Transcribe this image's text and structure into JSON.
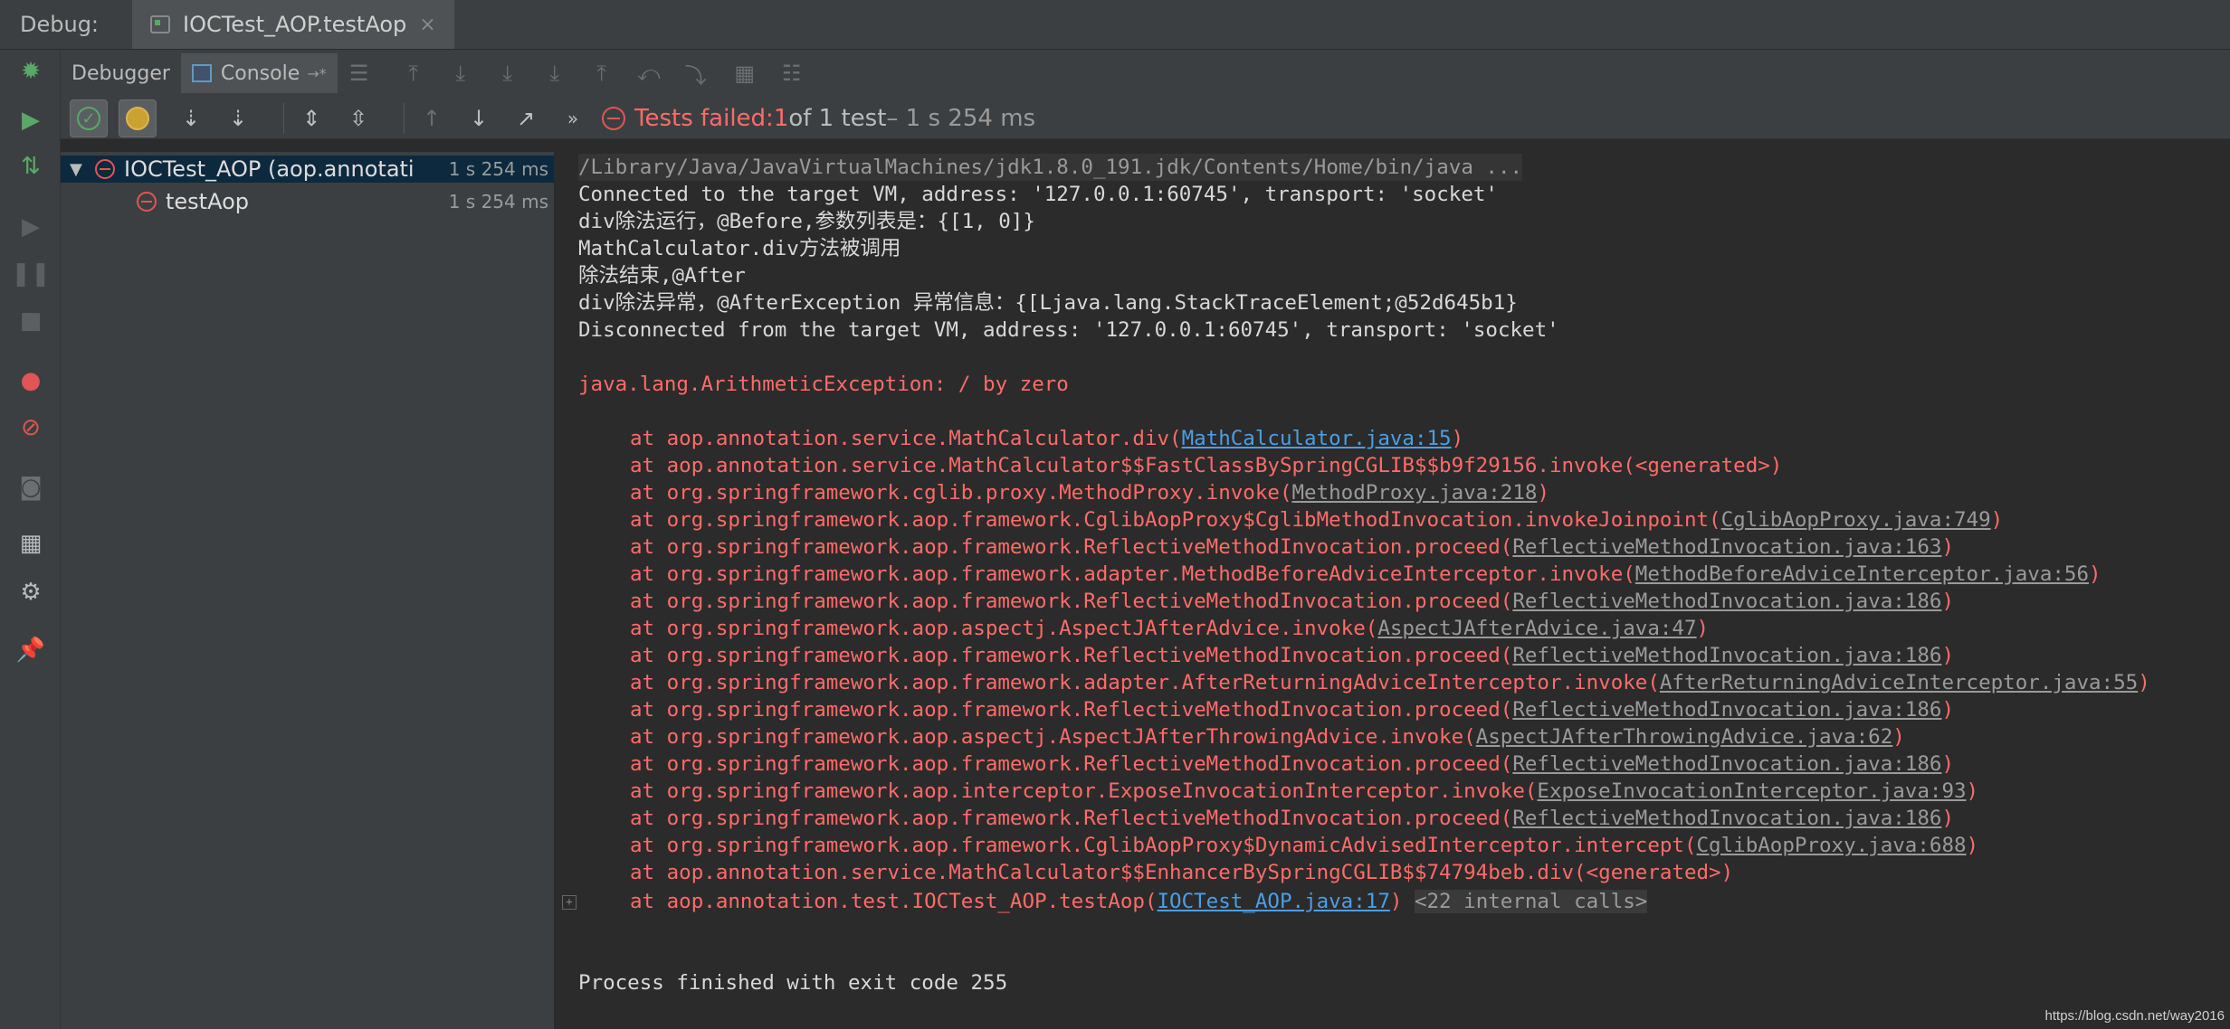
{
  "window": {
    "debug_label": "Debug:",
    "run_tab_label": "IOCTest_AOP.testAop",
    "run_tab_close": "×"
  },
  "toolbar": {
    "tab_debugger": "Debugger",
    "tab_console": "Console",
    "tab_console_pin": "→*",
    "overflow": "»"
  },
  "status": {
    "failed_prefix": "Tests failed: ",
    "failed_count": "1",
    "of_total": " of 1 test",
    "duration": " – 1 s 254 ms"
  },
  "tree": {
    "root_name": "IOCTest_AOP (aop.annotati",
    "root_time": "1 s 254 ms",
    "child_name": "testAop",
    "child_time": "1 s 254 ms"
  },
  "console": {
    "command": "/Library/Java/JavaVirtualMachines/jdk1.8.0_191.jdk/Contents/Home/bin/java ...",
    "lines": [
      "Connected to the target VM, address: '127.0.0.1:60745', transport: 'socket'",
      "div除法运行，@Before,参数列表是：{[1, 0]}",
      "MathCalculator.div方法被调用",
      "除法结束,@After",
      "div除法异常，@AfterException 异常信息：{[Ljava.lang.StackTraceElement;@52d645b1}",
      "Disconnected from the target VM, address: '127.0.0.1:60745', transport: 'socket'"
    ],
    "exception": "java.lang.ArithmeticException: / by zero",
    "stack": [
      {
        "pre": "at aop.annotation.service.MathCalculator.div(",
        "link": "MathCalculator.java:15",
        "post": ")"
      },
      {
        "pre": "at aop.annotation.service.MathCalculator$$FastClassBySpringCGLIB$$b9f29156.invoke(<generated>)",
        "link": "",
        "post": ""
      },
      {
        "pre": "at org.springframework.cglib.proxy.MethodProxy.invoke(",
        "link": "MethodProxy.java:218",
        "post": ")"
      },
      {
        "pre": "at org.springframework.aop.framework.CglibAopProxy$CglibMethodInvocation.invokeJoinpoint(",
        "link": "CglibAopProxy.java:749",
        "post": ")"
      },
      {
        "pre": "at org.springframework.aop.framework.ReflectiveMethodInvocation.proceed(",
        "link": "ReflectiveMethodInvocation.java:163",
        "post": ")"
      },
      {
        "pre": "at org.springframework.aop.framework.adapter.MethodBeforeAdviceInterceptor.invoke(",
        "link": "MethodBeforeAdviceInterceptor.java:56",
        "post": ")"
      },
      {
        "pre": "at org.springframework.aop.framework.ReflectiveMethodInvocation.proceed(",
        "link": "ReflectiveMethodInvocation.java:186",
        "post": ")"
      },
      {
        "pre": "at org.springframework.aop.aspectj.AspectJAfterAdvice.invoke(",
        "link": "AspectJAfterAdvice.java:47",
        "post": ")"
      },
      {
        "pre": "at org.springframework.aop.framework.ReflectiveMethodInvocation.proceed(",
        "link": "ReflectiveMethodInvocation.java:186",
        "post": ")"
      },
      {
        "pre": "at org.springframework.aop.framework.adapter.AfterReturningAdviceInterceptor.invoke(",
        "link": "AfterReturningAdviceInterceptor.java:55",
        "post": ")"
      },
      {
        "pre": "at org.springframework.aop.framework.ReflectiveMethodInvocation.proceed(",
        "link": "ReflectiveMethodInvocation.java:186",
        "post": ")"
      },
      {
        "pre": "at org.springframework.aop.aspectj.AspectJAfterThrowingAdvice.invoke(",
        "link": "AspectJAfterThrowingAdvice.java:62",
        "post": ")"
      },
      {
        "pre": "at org.springframework.aop.framework.ReflectiveMethodInvocation.proceed(",
        "link": "ReflectiveMethodInvocation.java:186",
        "post": ")"
      },
      {
        "pre": "at org.springframework.aop.interceptor.ExposeInvocationInterceptor.invoke(",
        "link": "ExposeInvocationInterceptor.java:93",
        "post": ")"
      },
      {
        "pre": "at org.springframework.aop.framework.ReflectiveMethodInvocation.proceed(",
        "link": "ReflectiveMethodInvocation.java:186",
        "post": ")"
      },
      {
        "pre": "at org.springframework.aop.framework.CglibAopProxy$DynamicAdvisedInterceptor.intercept(",
        "link": "CglibAopProxy.java:688",
        "post": ")"
      },
      {
        "pre": "at aop.annotation.service.MathCalculator$$EnhancerBySpringCGLIB$$74794beb.div(<generated>)",
        "link": "",
        "post": ""
      }
    ],
    "last_frame": {
      "pre": "at aop.annotation.test.IOCTest_AOP.testAop(",
      "link": "IOCTest_AOP.java:17",
      "post": ")",
      "internal": "<22 internal calls>"
    },
    "fold_marker": "+",
    "exit": "Process finished with exit code 255"
  },
  "watermark": "https://blog.csdn.net/way2016",
  "colors": {
    "error": "#ff6b68",
    "link": "#4a9fe7",
    "background": "#2b2b2b",
    "panel": "#3c3f41",
    "success": "#59a869"
  }
}
